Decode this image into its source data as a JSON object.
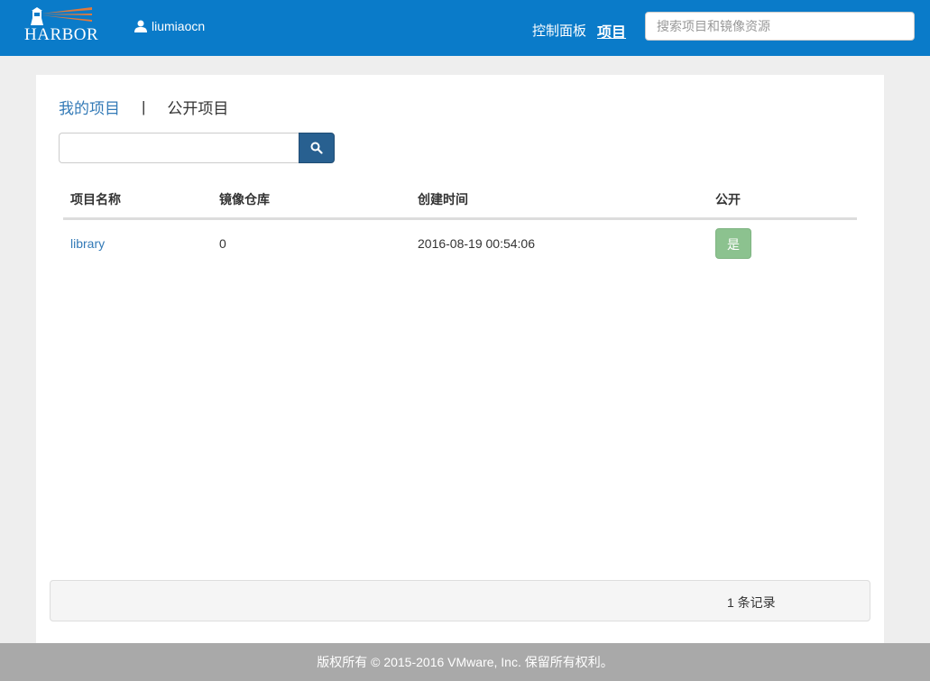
{
  "header": {
    "logo_text": "HARBOR",
    "username": "liumiaocn",
    "nav": {
      "dashboard": "控制面板",
      "projects": "项目"
    },
    "search_placeholder": "搜索项目和镜像资源",
    "bg_color": "#0a7bc9"
  },
  "tabs": {
    "my_projects": "我的项目",
    "separator": "|",
    "public_projects": "公开项目"
  },
  "search": {
    "value": ""
  },
  "table": {
    "columns": [
      "项目名称",
      "镜像仓库",
      "创建时间",
      "公开"
    ],
    "rows": [
      {
        "name": "library",
        "repos": "0",
        "created": "2016-08-19 00:54:06",
        "public": "是"
      }
    ]
  },
  "pager": {
    "count_text": "1 条记录"
  },
  "footer": {
    "text": "版权所有 © 2015-2016 VMware, Inc. 保留所有权利。"
  }
}
